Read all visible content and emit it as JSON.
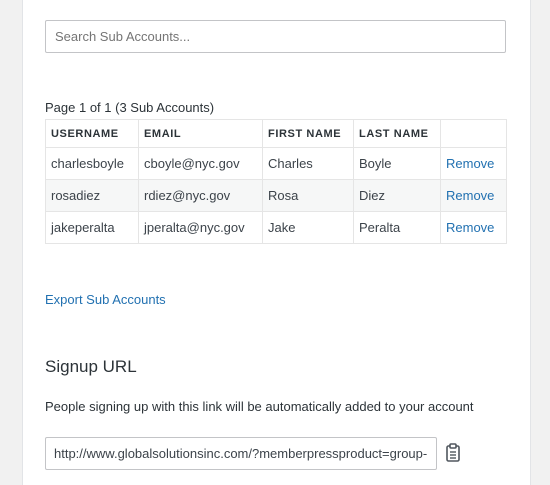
{
  "search": {
    "placeholder": "Search Sub Accounts..."
  },
  "pagination": {
    "text": "Page 1 of 1 (3 Sub Accounts)"
  },
  "table": {
    "headers": [
      "USERNAME",
      "EMAIL",
      "FIRST NAME",
      "LAST NAME"
    ],
    "rows": [
      {
        "username": "charlesboyle",
        "email": "cboyle@nyc.gov",
        "first_name": "Charles",
        "last_name": "Boyle",
        "action": "Remove"
      },
      {
        "username": "rosadiez",
        "email": "rdiez@nyc.gov",
        "first_name": "Rosa",
        "last_name": "Diez",
        "action": "Remove"
      },
      {
        "username": "jakeperalta",
        "email": "jperalta@nyc.gov",
        "first_name": "Jake",
        "last_name": "Peralta",
        "action": "Remove"
      }
    ]
  },
  "export_link": "Export Sub Accounts",
  "signup": {
    "heading": "Signup URL",
    "description": "People signing up with this link will be automatically added to your account",
    "url": "http://www.globalsolutionsinc.com/?memberpressproduct=group-m",
    "copy_icon": "clipboard-icon"
  },
  "colors": {
    "link": "#2271b1",
    "border": "#c3c4c7",
    "alt_row": "#f6f7f7"
  }
}
